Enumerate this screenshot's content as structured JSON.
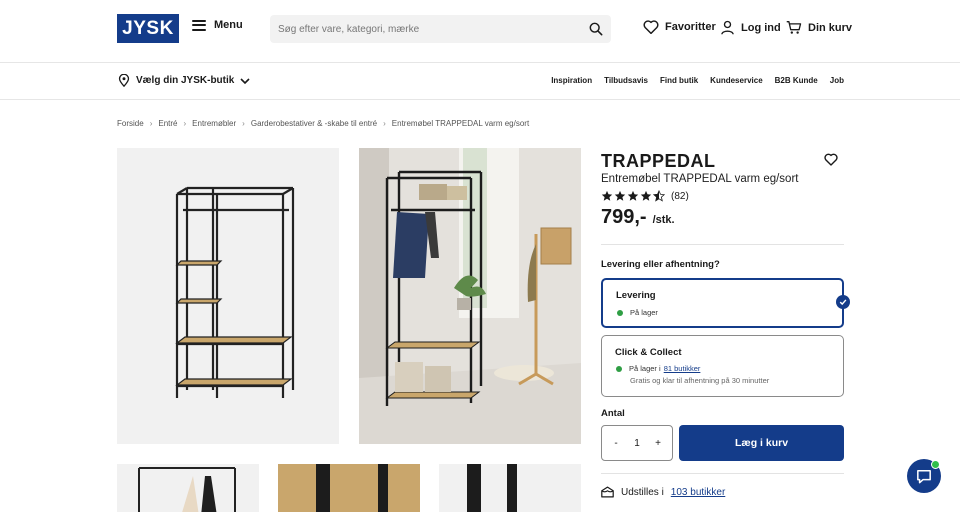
{
  "header": {
    "logo_text": "JYSK",
    "menu_label": "Menu",
    "search_placeholder": "Søg efter vare, kategori, mærke",
    "favorites_label": "Favoritter",
    "login_label": "Log ind",
    "cart_label": "Din kurv"
  },
  "subnav": {
    "store_picker_label": "Vælg din JYSK-butik",
    "links": [
      "Inspiration",
      "Tilbudsavis",
      "Find butik",
      "Kundeservice",
      "B2B Kunde",
      "Job"
    ]
  },
  "breadcrumb": [
    "Forside",
    "Entré",
    "Entremøbler",
    "Garderobestativer & -skabe til entré",
    "Entremøbel TRAPPEDAL varm eg/sort"
  ],
  "product": {
    "name": "TRAPPEDAL",
    "subtitle": "Entremøbel TRAPPEDAL varm eg/sort",
    "rating": 4.5,
    "rating_count": "(82)",
    "price": "799,-",
    "price_unit": "/stk."
  },
  "delivery": {
    "question": "Levering eller afhentning?",
    "options": [
      {
        "title": "Levering",
        "stock": "På lager",
        "selected": true
      },
      {
        "title": "Click & Collect",
        "stock_prefix": "På lager i",
        "stock_link": "81 butikker",
        "note": "Gratis og klar til afhentning på 30 minutter",
        "selected": false
      }
    ]
  },
  "quantity": {
    "label": "Antal",
    "value": "1",
    "minus": "-",
    "plus": "+"
  },
  "add_to_cart_label": "Læg i kurv",
  "display": {
    "prefix": "Udstilles i",
    "link": "103 butikker"
  },
  "colors": {
    "brand_blue": "#143c8a",
    "stock_green": "#2f9e44"
  }
}
